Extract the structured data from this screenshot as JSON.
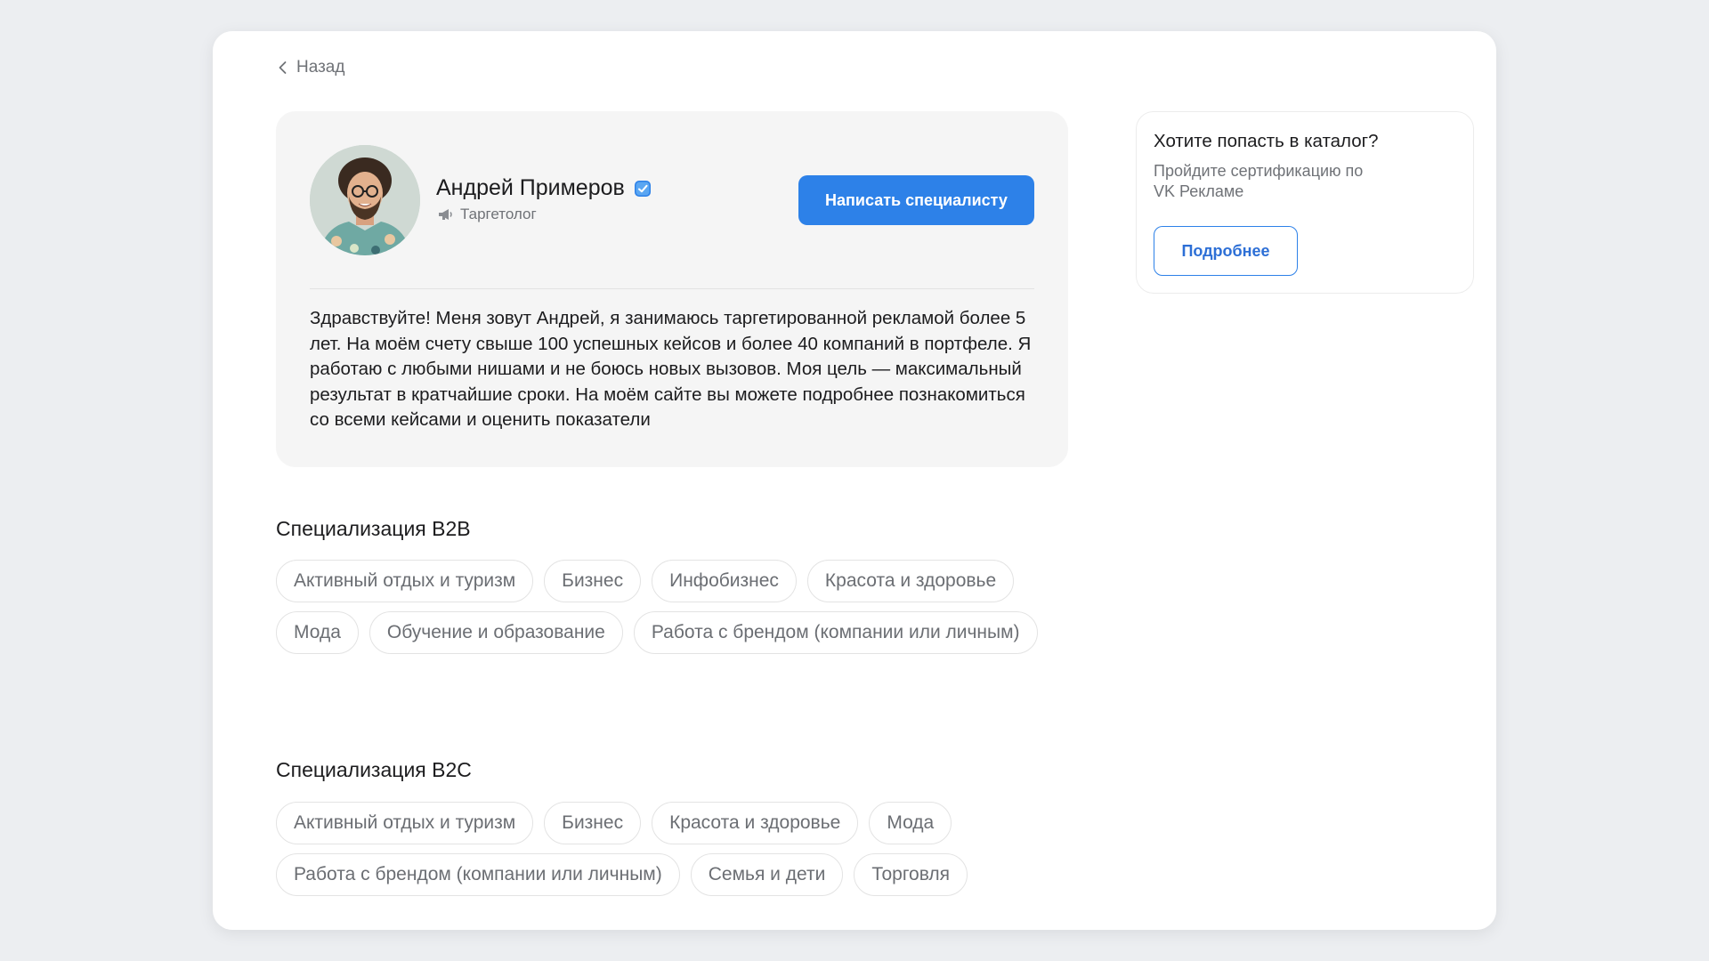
{
  "nav": {
    "back_label": "Назад"
  },
  "profile": {
    "name": "Андрей Примеров",
    "role": "Таргетолог",
    "contact_button": "Написать специалисту",
    "bio": "Здравствуйте! Меня зовут Андрей, я занимаюсь таргетированной рекламой более 5 лет. На моём счету свыше 100 успешных кейсов и более 40 компаний в портфеле. Я работаю с любыми нишами и не боюсь новых вызовов. Моя цель — максимальный результат в кратчайшие сроки. На моём сайте вы можете подробнее познакомиться со всеми кейсами и оценить показатели",
    "icons": {
      "verified": "verified-badge-icon",
      "role": "megaphone-icon"
    }
  },
  "b2b": {
    "title": "Специализация B2B",
    "tags": [
      "Активный отдых и туризм",
      "Бизнес",
      "Инфобизнес",
      "Красота и здоровье",
      "Мода",
      "Обучение и образование",
      "Работа с брендом (компании или личным)"
    ]
  },
  "b2c": {
    "title": "Специализация B2C",
    "tags": [
      "Активный отдых и туризм",
      "Бизнес",
      "Красота и здоровье",
      "Мода",
      "Работа с брендом (компании или личным)",
      "Семья и дети",
      "Торговля"
    ]
  },
  "catalog_promo": {
    "title": "Хотите попасть в каталог?",
    "text": "Пройдите сертификацию по VK Рекламе",
    "button": "Подробнее"
  },
  "colors": {
    "accent": "#2d81e8",
    "background": "#eceef1",
    "card": "#f5f5f5"
  }
}
